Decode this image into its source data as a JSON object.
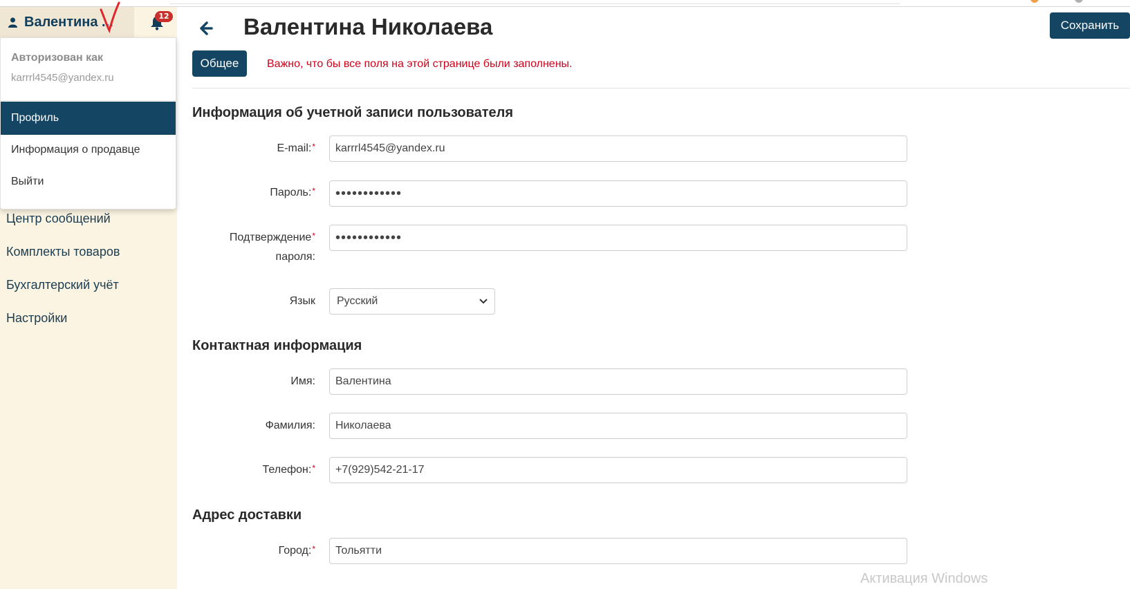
{
  "user": {
    "name": "Валентина ...",
    "notifications": "12"
  },
  "dropdown": {
    "auth_head": "Авторизован как",
    "auth_email": "karrrl4545@yandex.ru",
    "items": [
      "Профиль",
      "Информация о продавце",
      "Выйти"
    ]
  },
  "sidebar": {
    "items": [
      "Центр сообщений",
      "Комплекты товаров",
      "Бухгалтерский учёт",
      "Настройки"
    ]
  },
  "header": {
    "title": "Валентина Николаева",
    "save": "Сохранить"
  },
  "tabs": {
    "general": "Общее"
  },
  "warning": "Важно, что бы все поля на этой странице были заполнены.",
  "sections": {
    "account": "Информация об учетной записи пользователя",
    "contact": "Контактная информация",
    "delivery": "Адрес доставки"
  },
  "fields": {
    "email": {
      "label": "E-mail:",
      "value": "karrrl4545@yandex.ru"
    },
    "password": {
      "label": "Пароль:",
      "value": "••••••••••••"
    },
    "confirm": {
      "label1": "Подтверждение",
      "label2": "пароля:",
      "value": "••••••••••••"
    },
    "language": {
      "label": "Язык",
      "value": "Русский"
    },
    "first_name": {
      "label": "Имя:",
      "value": "Валентина"
    },
    "last_name": {
      "label": "Фамилия:",
      "value": "Николаева"
    },
    "phone": {
      "label": "Телефон:",
      "value": "+7(929)542-21-17"
    },
    "city": {
      "label": "Город:",
      "value": "Тольятти"
    }
  },
  "required_mark": "*",
  "watermark": "Активация Windows",
  "colors": {
    "primary": "#144563",
    "sidebar_bg": "#fbf4e2",
    "warning": "#d0021b",
    "badge": "#c9302c",
    "annotation": "#e0262b"
  }
}
